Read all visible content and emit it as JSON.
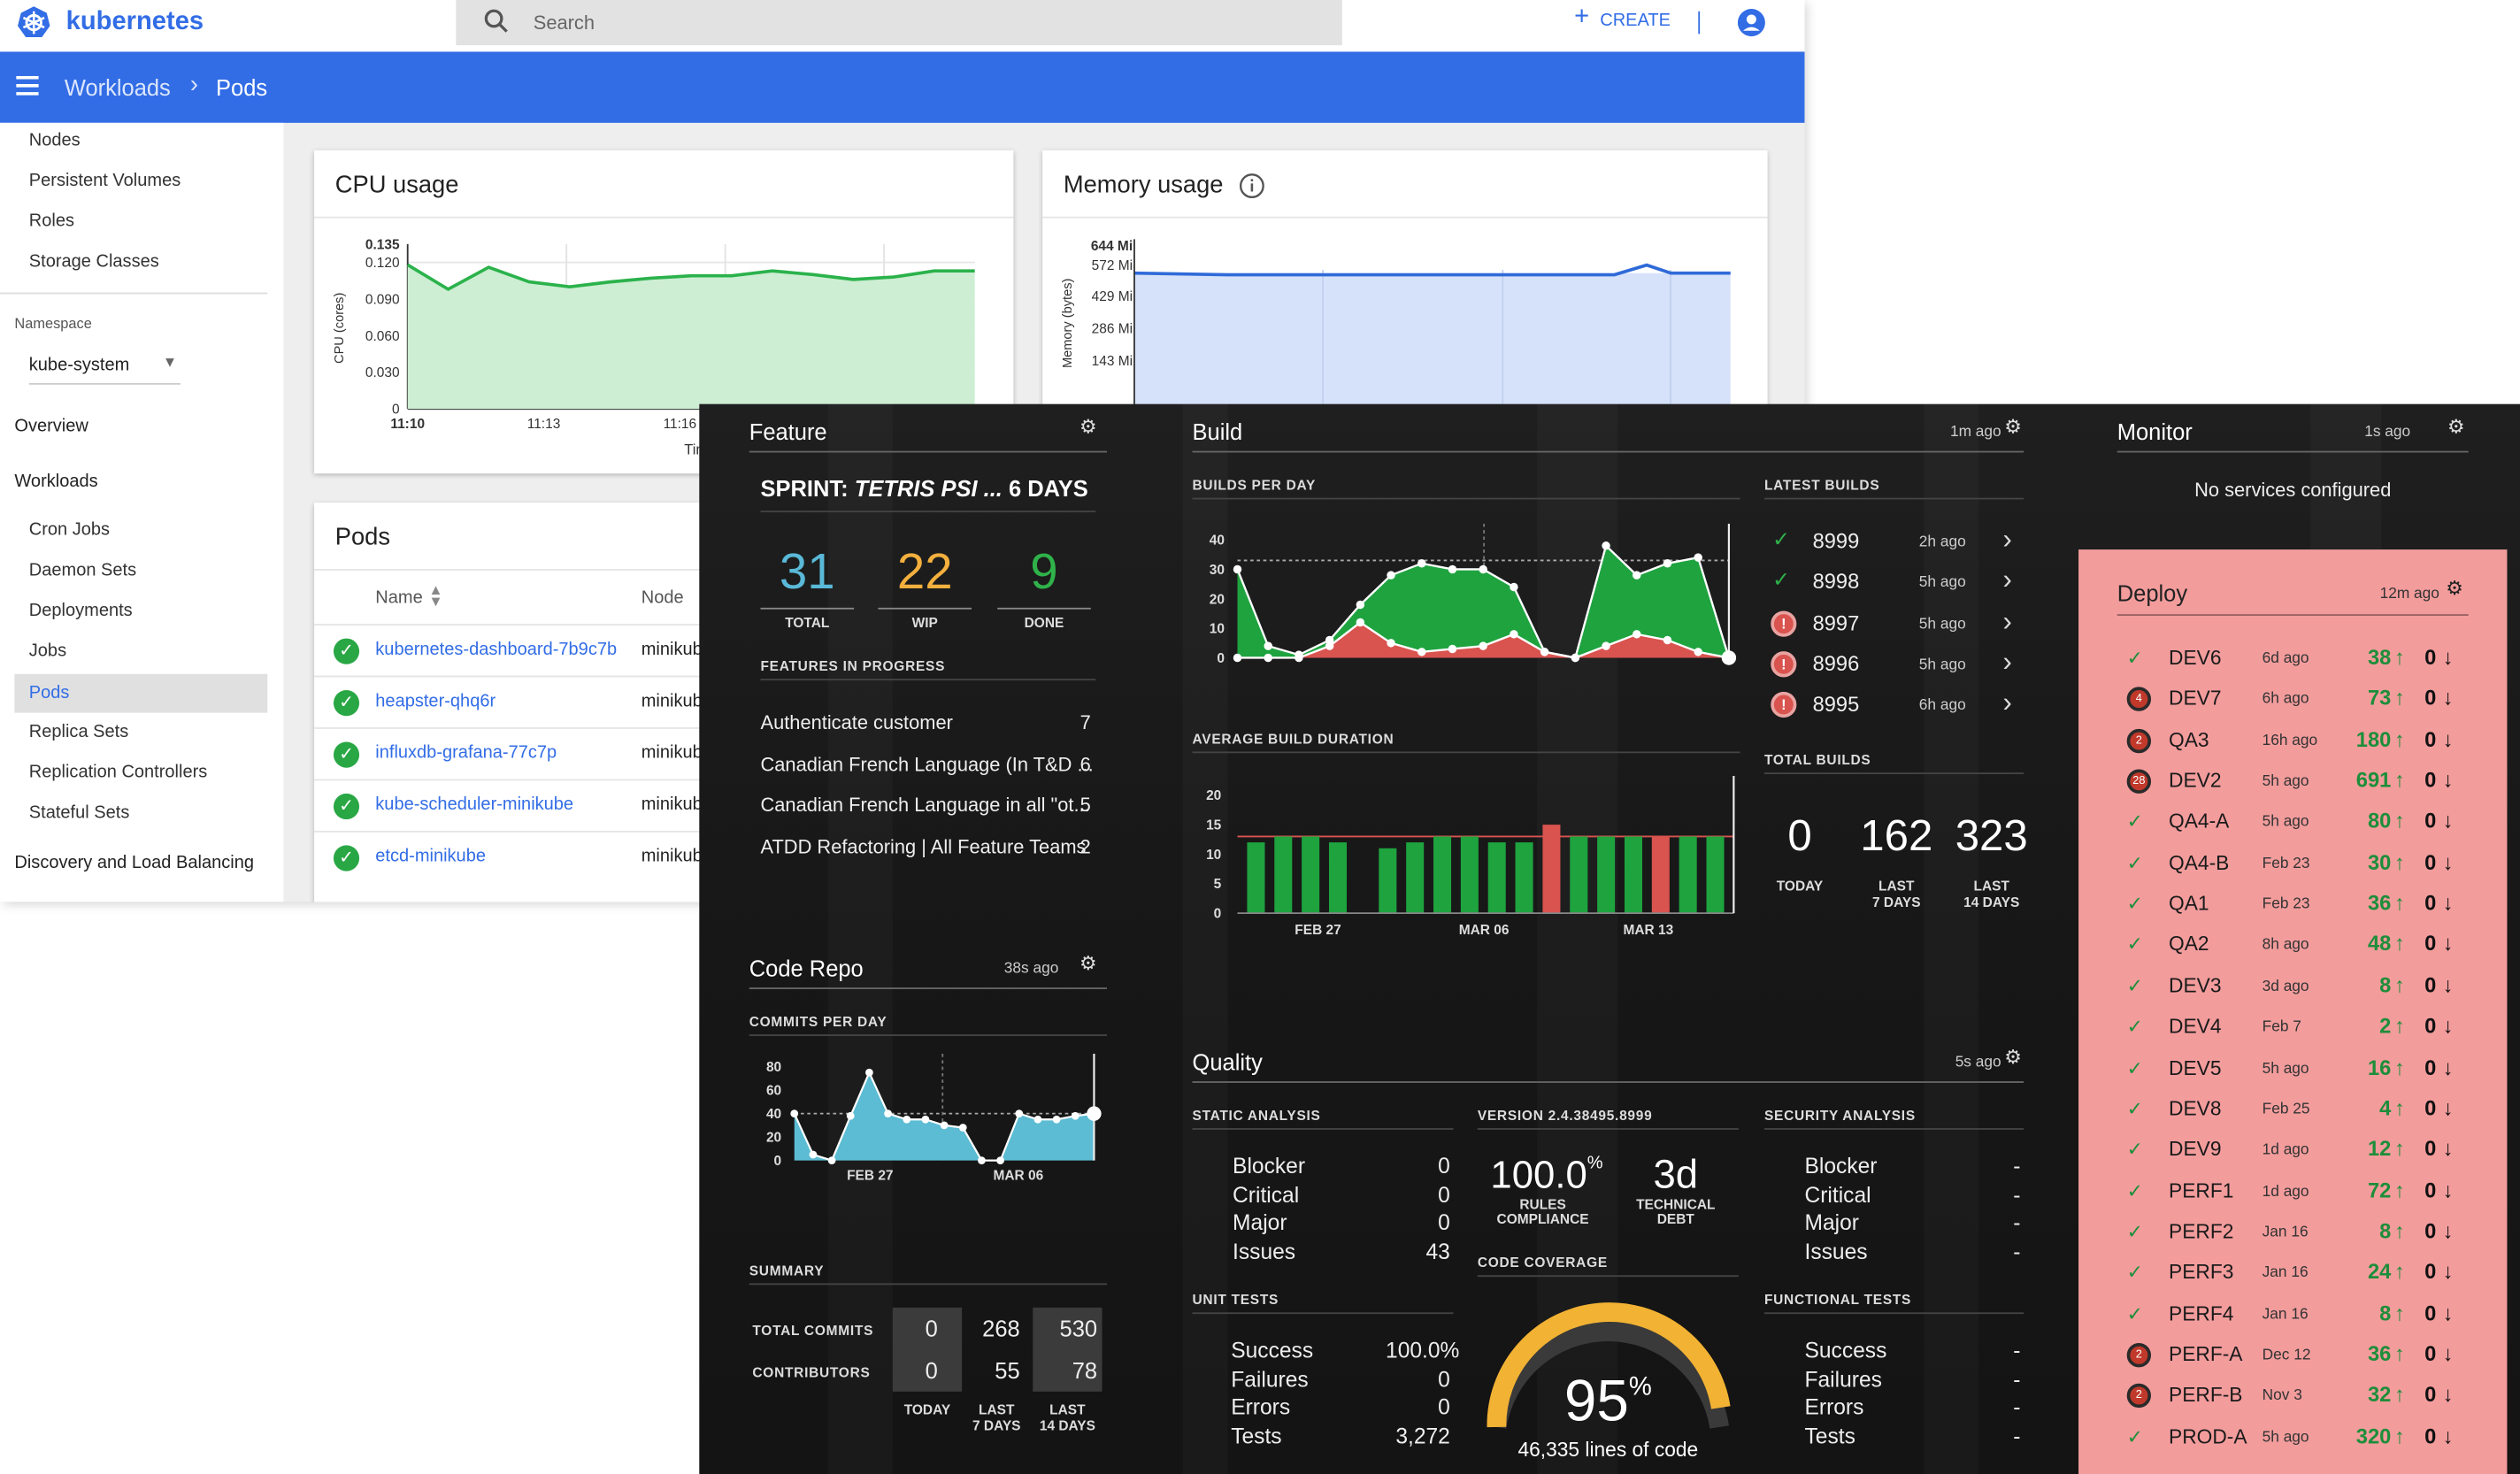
{
  "k8s": {
    "brand": "kubernetes",
    "search_placeholder": "Search",
    "create_label": "CREATE",
    "breadcrumb_parent": "Workloads",
    "breadcrumb_current": "Pods",
    "nav_top": [
      "Nodes",
      "Persistent Volumes",
      "Roles",
      "Storage Classes"
    ],
    "namespace_label": "Namespace",
    "namespace_value": "kube-system",
    "overview": "Overview",
    "workloads": "Workloads",
    "workload_items": [
      "Cron Jobs",
      "Daemon Sets",
      "Deployments",
      "Jobs",
      "Pods",
      "Replica Sets",
      "Replication Controllers",
      "Stateful Sets"
    ],
    "discovery": "Discovery and Load Balancing",
    "cpu_title": "CPU usage",
    "cpu_ylabel": "CPU (cores)",
    "cpu_yticks": [
      "0.135",
      "0.120",
      "0.090",
      "0.060",
      "0.030",
      "0"
    ],
    "cpu_xticks": [
      "11:10",
      "11:13",
      "11:16"
    ],
    "cpu_xlabel": "Tim",
    "cpu_values": [
      0.118,
      0.098,
      0.116,
      0.104,
      0.1,
      0.104,
      0.107,
      0.109,
      0.109,
      0.113,
      0.11,
      0.106,
      0.108,
      0.113,
      0.113
    ],
    "mem_title": "Memory usage",
    "mem_ylabel": "Memory (bytes)",
    "mem_yticks": [
      "644 Mi",
      "572 Mi",
      "429 Mi",
      "286 Mi",
      "143 Mi"
    ],
    "pods_title": "Pods",
    "pods_col_name": "Name",
    "pods_col_node": "Node",
    "pods": [
      {
        "name": "kubernetes-dashboard-7b9c7b",
        "node": "minikub"
      },
      {
        "name": "heapster-qhq6r",
        "node": "minikub"
      },
      {
        "name": "influxdb-grafana-77c7p",
        "node": "minikub"
      },
      {
        "name": "kube-scheduler-minikube",
        "node": "minikub"
      },
      {
        "name": "etcd-minikube",
        "node": "minikub"
      }
    ]
  },
  "feature": {
    "title": "Feature",
    "sprint_prefix": "SPRINT:",
    "sprint_name": "TETRIS PSI ...",
    "sprint_days": "6 DAYS",
    "total": "31",
    "total_label": "TOTAL",
    "wip": "22",
    "wip_label": "WIP",
    "done": "9",
    "done_label": "DONE",
    "in_progress_label": "FEATURES IN PROGRESS",
    "items": [
      {
        "name": "Authenticate customer",
        "count": "7"
      },
      {
        "name": "Canadian French Language (In T&D ...",
        "count": "6"
      },
      {
        "name": "Canadian French Language in all \"ot...",
        "count": "5"
      },
      {
        "name": "ATDD Refactoring | All Feature Teams",
        "count": "2"
      }
    ]
  },
  "coderepo": {
    "title": "Code Repo",
    "ago": "38s ago",
    "commits_label": "COMMITS PER DAY",
    "yticks": [
      "80",
      "60",
      "40",
      "20",
      "0"
    ],
    "xticks": [
      "FEB 27",
      "MAR 06"
    ],
    "commits": [
      40,
      5,
      0,
      38,
      75,
      40,
      35,
      35,
      30,
      28,
      0,
      0,
      40,
      35,
      35,
      38,
      40
    ],
    "summary_label": "SUMMARY",
    "total_commits_label": "TOTAL COMMITS",
    "contributors_label": "CONTRIBUTORS",
    "total_commits": [
      "0",
      "268",
      "530"
    ],
    "contributors": [
      "0",
      "55",
      "78"
    ],
    "periods": [
      "TODAY",
      "LAST\n7 DAYS",
      "LAST\n14 DAYS"
    ]
  },
  "build": {
    "title": "Build",
    "ago": "1m ago",
    "per_day_label": "BUILDS PER DAY",
    "per_day_yticks": [
      "40",
      "30",
      "20",
      "10",
      "0"
    ],
    "success": [
      30,
      4,
      1,
      6,
      18,
      28,
      32,
      30,
      30,
      24,
      2,
      0,
      38,
      28,
      32,
      34,
      0
    ],
    "failed": [
      0,
      0,
      0,
      4,
      12,
      5,
      2,
      3,
      4,
      8,
      2,
      0,
      4,
      8,
      6,
      2,
      0
    ],
    "avg_label": "AVERAGE BUILD DURATION",
    "avg_yticks": [
      "20",
      "15",
      "10",
      "5",
      "0"
    ],
    "avg_xticks": [
      "FEB 27",
      "MAR 06",
      "MAR 13"
    ],
    "durations": [
      12,
      13,
      13,
      12,
      11,
      12,
      13,
      13,
      12,
      12,
      15,
      13,
      13,
      13,
      13,
      13,
      13
    ],
    "duration_failed": [
      false,
      false,
      false,
      false,
      false,
      false,
      false,
      false,
      false,
      false,
      true,
      false,
      false,
      false,
      true,
      false,
      false
    ],
    "latest_label": "LATEST BUILDS",
    "latest": [
      {
        "num": "8999",
        "ago": "2h ago",
        "ok": true
      },
      {
        "num": "8998",
        "ago": "5h ago",
        "ok": true
      },
      {
        "num": "8997",
        "ago": "5h ago",
        "ok": false
      },
      {
        "num": "8996",
        "ago": "5h ago",
        "ok": false
      },
      {
        "num": "8995",
        "ago": "6h ago",
        "ok": false
      }
    ],
    "total_label": "TOTAL BUILDS",
    "totals": [
      "0",
      "162",
      "323"
    ],
    "total_periods": [
      "TODAY",
      "LAST\n7 DAYS",
      "LAST\n14 DAYS"
    ]
  },
  "quality": {
    "title": "Quality",
    "ago": "5s ago",
    "static_label": "STATIC ANALYSIS",
    "static": [
      {
        "k": "Blocker",
        "v": "0"
      },
      {
        "k": "Critical",
        "v": "0"
      },
      {
        "k": "Major",
        "v": "0"
      },
      {
        "k": "Issues",
        "v": "43"
      }
    ],
    "version_label": "VERSION 2.4.38495.8999",
    "rules_value": "100.0",
    "rules_unit": "%",
    "rules_label": "RULES\nCOMPLIANCE",
    "debt_value": "3d",
    "debt_label": "TECHNICAL\nDEBT",
    "security_label": "SECURITY ANALYSIS",
    "security": [
      {
        "k": "Blocker",
        "v": "-"
      },
      {
        "k": "Critical",
        "v": "-"
      },
      {
        "k": "Major",
        "v": "-"
      },
      {
        "k": "Issues",
        "v": "-"
      }
    ],
    "unit_label": "UNIT TESTS",
    "unit": [
      {
        "k": "Success",
        "v": "100.0%"
      },
      {
        "k": "Failures",
        "v": "0"
      },
      {
        "k": "Errors",
        "v": "0"
      },
      {
        "k": "Tests",
        "v": "3,272"
      }
    ],
    "coverage_label": "CODE COVERAGE",
    "coverage_value": "95",
    "coverage_unit": "%",
    "coverage_fraction": 0.95,
    "coverage_lines": "46,335 lines of code",
    "functional_label": "FUNCTIONAL TESTS",
    "functional": [
      {
        "k": "Success",
        "v": "-"
      },
      {
        "k": "Failures",
        "v": "-"
      },
      {
        "k": "Errors",
        "v": "-"
      },
      {
        "k": "Tests",
        "v": "-"
      }
    ]
  },
  "monitor": {
    "title": "Monitor",
    "ago": "1s ago",
    "empty": "No services configured"
  },
  "deploy": {
    "title": "Deploy",
    "ago": "12m ago",
    "envs": [
      {
        "name": "DEV6",
        "ago": "6d ago",
        "up": "38",
        "down": "0",
        "status": "ok",
        "badge": ""
      },
      {
        "name": "DEV7",
        "ago": "6h ago",
        "up": "73",
        "down": "0",
        "status": "bad",
        "badge": "4"
      },
      {
        "name": "QA3",
        "ago": "16h ago",
        "up": "180",
        "down": "0",
        "status": "bad",
        "badge": "2"
      },
      {
        "name": "DEV2",
        "ago": "5h ago",
        "up": "691",
        "down": "0",
        "status": "bad",
        "badge": "28"
      },
      {
        "name": "QA4-A",
        "ago": "5h ago",
        "up": "80",
        "down": "0",
        "status": "ok",
        "badge": ""
      },
      {
        "name": "QA4-B",
        "ago": "Feb 23",
        "up": "30",
        "down": "0",
        "status": "ok",
        "badge": ""
      },
      {
        "name": "QA1",
        "ago": "Feb 23",
        "up": "36",
        "down": "0",
        "status": "ok",
        "badge": ""
      },
      {
        "name": "QA2",
        "ago": "8h ago",
        "up": "48",
        "down": "0",
        "status": "ok",
        "badge": ""
      },
      {
        "name": "DEV3",
        "ago": "3d ago",
        "up": "8",
        "down": "0",
        "status": "ok",
        "badge": ""
      },
      {
        "name": "DEV4",
        "ago": "Feb 7",
        "up": "2",
        "down": "0",
        "status": "ok",
        "badge": ""
      },
      {
        "name": "DEV5",
        "ago": "5h ago",
        "up": "16",
        "down": "0",
        "status": "ok",
        "badge": ""
      },
      {
        "name": "DEV8",
        "ago": "Feb 25",
        "up": "4",
        "down": "0",
        "status": "ok",
        "badge": ""
      },
      {
        "name": "DEV9",
        "ago": "1d ago",
        "up": "12",
        "down": "0",
        "status": "ok",
        "badge": ""
      },
      {
        "name": "PERF1",
        "ago": "1d ago",
        "up": "72",
        "down": "0",
        "status": "ok",
        "badge": ""
      },
      {
        "name": "PERF2",
        "ago": "Jan 16",
        "up": "8",
        "down": "0",
        "status": "ok",
        "badge": ""
      },
      {
        "name": "PERF3",
        "ago": "Jan 16",
        "up": "24",
        "down": "0",
        "status": "ok",
        "badge": ""
      },
      {
        "name": "PERF4",
        "ago": "Jan 16",
        "up": "8",
        "down": "0",
        "status": "ok",
        "badge": ""
      },
      {
        "name": "PERF-A",
        "ago": "Dec 12",
        "up": "36",
        "down": "0",
        "status": "bad",
        "badge": "2"
      },
      {
        "name": "PERF-B",
        "ago": "Nov 3",
        "up": "32",
        "down": "0",
        "status": "bad",
        "badge": "2"
      },
      {
        "name": "PROD-A",
        "ago": "5h ago",
        "up": "320",
        "down": "0",
        "status": "ok",
        "badge": ""
      }
    ]
  },
  "colors": {
    "k8s_blue": "#326de6",
    "deploy_bg": "#f39c9c",
    "success_green": "#1ea33f",
    "fail_red": "#d9534f",
    "coverage_gold": "#f2b233",
    "commits_blue": "#5bbcd3"
  }
}
